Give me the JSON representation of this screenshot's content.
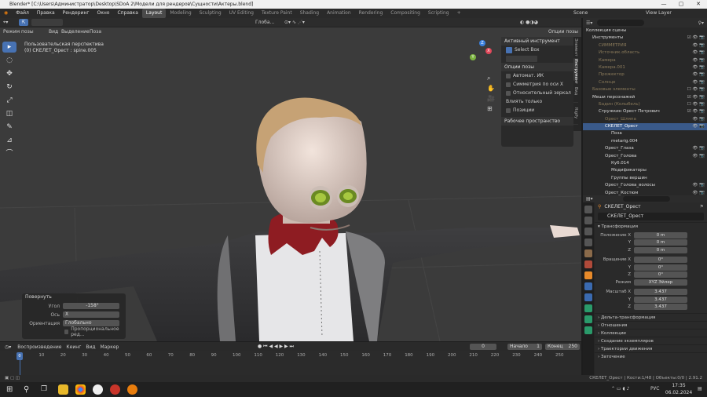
{
  "window": {
    "title": "Blender* [C:\\Users\\Администратор\\Desktop\\SDoA 2\\Модели для рендеров\\Сущности\\Актеры.blend]",
    "controls": [
      "—",
      "▢",
      "✕"
    ]
  },
  "menu": {
    "items": [
      "Файл",
      "Правка",
      "Рендеринг",
      "Окно",
      "Справка"
    ],
    "workspaces": [
      "Layout",
      "Modeling",
      "Sculpting",
      "UV Editing",
      "Texture Paint",
      "Shading",
      "Animation",
      "Rendering",
      "Compositing",
      "Scripting"
    ],
    "active_workspace": "Layout",
    "add_tab": "+",
    "scene_label": "Scene",
    "view_layer_label": "View Layer"
  },
  "viewport": {
    "mode": "Режим позы",
    "menus": [
      "Вид",
      "Выделение",
      "Поза"
    ],
    "orientation": "Глоба...",
    "overlay_text": "Пользовательская перспектива",
    "overlay_sub": "(0) СКЕЛЕТ_Орест : spine.005",
    "options_label": "Опции позы",
    "tools": [
      "▸",
      "◌",
      "✥",
      "↻",
      "⤢",
      "◫",
      "✎",
      "⊿",
      "⌒"
    ],
    "gizmo_axes": [
      "X",
      "Y",
      "Z"
    ]
  },
  "tool_panel": {
    "header": "Активный инструмент",
    "select_box": "Select Box",
    "pose_options": "Опции позы",
    "auto_ik": "Автомат. ИК",
    "x_mirror": "Симметрия по оси X",
    "relative_mirror": "Относительный зеркал",
    "affect_only": "Влиять только",
    "positions": "Позиции",
    "workspace": "Рабочее пространство",
    "tabs": [
      "Элемент",
      "Инструмент",
      "Вид",
      "Rigify"
    ]
  },
  "operator_panel": {
    "title": "Повернуть",
    "angle_label": "Угол",
    "angle_value": "-158°",
    "axis_label": "Ось",
    "axis_value": "X",
    "orient_label": "Ориентация",
    "orient_value": "Глобально",
    "proportional": "Пропорциональное ред..."
  },
  "timeline": {
    "menus": [
      "Воспроизведение",
      "Кеинг",
      "Вид",
      "Маркер"
    ],
    "current_frame": "0",
    "start_label": "Начало",
    "start_value": "1",
    "end_label": "Конец",
    "end_value": "250",
    "ticks": [
      "0",
      "10",
      "20",
      "30",
      "40",
      "50",
      "60",
      "70",
      "80",
      "90",
      "100",
      "110",
      "120",
      "130",
      "140",
      "150",
      "160",
      "170",
      "180",
      "190",
      "200",
      "210",
      "220",
      "230",
      "240",
      "250"
    ],
    "playhead": "0"
  },
  "outliner": {
    "rows": [
      {
        "label": "Коллекция сцены",
        "indent": 0,
        "vis": ""
      },
      {
        "label": "Инструменты",
        "indent": 1,
        "vis": "☑ 👁 📷"
      },
      {
        "label": "СИММЕТРИЯ",
        "indent": 2,
        "vis": "👁 📷",
        "dim": true
      },
      {
        "label": "Источник.область",
        "indent": 2,
        "vis": "👁 📷",
        "dim": true
      },
      {
        "label": "Камера",
        "indent": 2,
        "vis": "👁 📷",
        "dim": true
      },
      {
        "label": "Камера.001",
        "indent": 2,
        "vis": "👁 📷",
        "dim": true
      },
      {
        "label": "Прожектор",
        "indent": 2,
        "vis": "👁 📷",
        "dim": true
      },
      {
        "label": "Солнце",
        "indent": 2,
        "vis": "👁 📷",
        "dim": true
      },
      {
        "label": "Базовые элементы",
        "indent": 1,
        "vis": "☐ 👁 📷",
        "dim": true
      },
      {
        "label": "Меши персонажей",
        "indent": 1,
        "vis": "☑ 👁 📷"
      },
      {
        "label": "Бадин (Колыбель)",
        "indent": 2,
        "vis": "☐ 👁 📷",
        "dim": true
      },
      {
        "label": "Стружкин Орест Петрович",
        "indent": 2,
        "vis": "☑ 👁 📷"
      },
      {
        "label": "Орест_Шляпа",
        "indent": 3,
        "vis": "👁 📷",
        "dim": true
      },
      {
        "label": "СКЕЛЕТ_Орест",
        "indent": 3,
        "vis": "👁 📷",
        "sel": true
      },
      {
        "label": "Поза",
        "indent": 4,
        "vis": ""
      },
      {
        "label": "metarig.004",
        "indent": 4,
        "vis": ""
      },
      {
        "label": "Орест_Глаза",
        "indent": 3,
        "vis": "👁 📷"
      },
      {
        "label": "Орест_Голова",
        "indent": 3,
        "vis": "👁 📷"
      },
      {
        "label": "Куб.014",
        "indent": 4,
        "vis": ""
      },
      {
        "label": "Модификаторы",
        "indent": 4,
        "vis": ""
      },
      {
        "label": "Группы вершин",
        "indent": 4,
        "vis": ""
      },
      {
        "label": "Орест_Голова_волосы",
        "indent": 3,
        "vis": "👁 📷"
      },
      {
        "label": "Орест_Костюм",
        "indent": 3,
        "vis": "👁 📷"
      }
    ]
  },
  "properties": {
    "object_name": "СКЕЛЕТ_Орест",
    "data_name": "СКЕЛЕТ_Орест",
    "transform": "Трансформация",
    "loc_label": "Положение X",
    "loc": [
      "0 m",
      "0 m",
      "0 m"
    ],
    "rot_label": "Вращение X",
    "rot": [
      "0°",
      "0°",
      "0°"
    ],
    "mode_label": "Режим",
    "mode_value": "XYZ Эйлер",
    "scale_label": "Масштаб X",
    "scale": [
      "3.437",
      "3.437",
      "3.437"
    ],
    "axis_y": "Y",
    "axis_z": "Z",
    "sections": [
      "Дельта-трансформация",
      "Отношения",
      "Коллекции",
      "Создание экземпляров",
      "Траектории движения",
      "Заточение"
    ]
  },
  "status": {
    "right": "СКЕЛЕТ_Орест | Кости:1/48 | Объекты:0/0 | 2.91.2"
  },
  "taskbar": {
    "time": "17:35",
    "date": "06.02.2024",
    "lang": "РУС"
  },
  "colors": {
    "accent": "#4772b3",
    "panel": "#2a2a2a",
    "viewport": "#3a3a3a"
  }
}
